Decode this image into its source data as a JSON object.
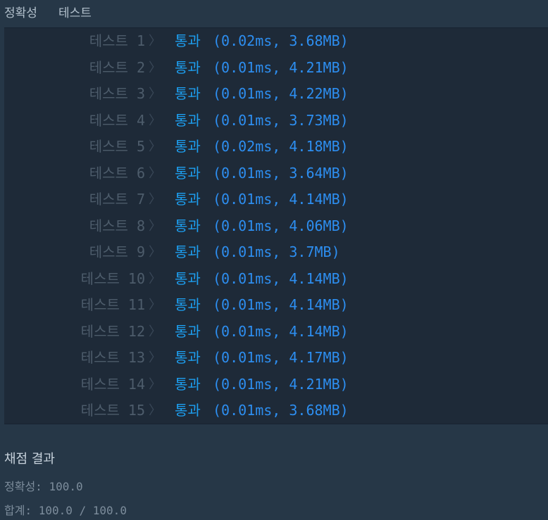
{
  "header": {
    "col1": "정확성",
    "col2": "테스트"
  },
  "tests": [
    {
      "label": "테스트 1",
      "status": "통과",
      "detail": "(0.02ms, 3.68MB)"
    },
    {
      "label": "테스트 2",
      "status": "통과",
      "detail": "(0.01ms, 4.21MB)"
    },
    {
      "label": "테스트 3",
      "status": "통과",
      "detail": "(0.01ms, 4.22MB)"
    },
    {
      "label": "테스트 4",
      "status": "통과",
      "detail": "(0.01ms, 3.73MB)"
    },
    {
      "label": "테스트 5",
      "status": "통과",
      "detail": "(0.02ms, 4.18MB)"
    },
    {
      "label": "테스트 6",
      "status": "통과",
      "detail": "(0.01ms, 3.64MB)"
    },
    {
      "label": "테스트 7",
      "status": "통과",
      "detail": "(0.01ms, 4.14MB)"
    },
    {
      "label": "테스트 8",
      "status": "통과",
      "detail": "(0.01ms, 4.06MB)"
    },
    {
      "label": "테스트 9",
      "status": "통과",
      "detail": "(0.01ms, 3.7MB)"
    },
    {
      "label": "테스트 10",
      "status": "통과",
      "detail": "(0.01ms, 4.14MB)"
    },
    {
      "label": "테스트 11",
      "status": "통과",
      "detail": "(0.01ms, 4.14MB)"
    },
    {
      "label": "테스트 12",
      "status": "통과",
      "detail": "(0.01ms, 4.14MB)"
    },
    {
      "label": "테스트 13",
      "status": "통과",
      "detail": "(0.01ms, 4.17MB)"
    },
    {
      "label": "테스트 14",
      "status": "통과",
      "detail": "(0.01ms, 4.21MB)"
    },
    {
      "label": "테스트 15",
      "status": "통과",
      "detail": "(0.01ms, 3.68MB)"
    }
  ],
  "summary": {
    "title": "채점 결과",
    "accuracy_label": "정확성:",
    "accuracy_value": "100.0",
    "total_label": "합계:",
    "total_value": "100.0 / 100.0"
  },
  "colors": {
    "background": "#263747",
    "panel": "#1e2a38",
    "pass": "#1d9ff0",
    "label": "#4d5c6b"
  },
  "icons": {
    "row_separator": "chevron-right-icon"
  }
}
